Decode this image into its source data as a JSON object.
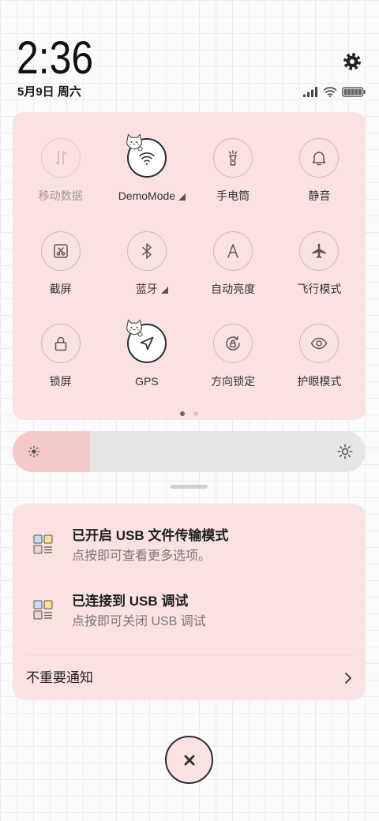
{
  "status_bar": {
    "time": "2:36",
    "date": "5月9日 周六",
    "icons": [
      "signal-icon",
      "wifi-icon",
      "battery-icon"
    ]
  },
  "header": {
    "settings_icon": "gear-icon"
  },
  "quick_settings": {
    "tiles": [
      {
        "label": "移动数据",
        "icon": "mobile-data-icon",
        "active": false,
        "disabled": true,
        "has_more": false
      },
      {
        "label": "DemoMode",
        "icon": "wifi-icon",
        "active": true,
        "disabled": false,
        "has_more": true
      },
      {
        "label": "手电筒",
        "icon": "flashlight-icon",
        "active": false,
        "disabled": false,
        "has_more": false
      },
      {
        "label": "静音",
        "icon": "bell-icon",
        "active": false,
        "disabled": false,
        "has_more": false
      },
      {
        "label": "截屏",
        "icon": "screenshot-icon",
        "active": false,
        "disabled": false,
        "has_more": false
      },
      {
        "label": "蓝牙",
        "icon": "bluetooth-icon",
        "active": false,
        "disabled": false,
        "has_more": true
      },
      {
        "label": "自动亮度",
        "icon": "auto-brightness-icon",
        "active": false,
        "disabled": false,
        "has_more": false
      },
      {
        "label": "飞行模式",
        "icon": "airplane-icon",
        "active": false,
        "disabled": false,
        "has_more": false
      },
      {
        "label": "锁屏",
        "icon": "lock-icon",
        "active": false,
        "disabled": false,
        "has_more": false
      },
      {
        "label": "GPS",
        "icon": "location-arrow-icon",
        "active": true,
        "disabled": false,
        "has_more": false
      },
      {
        "label": "方向锁定",
        "icon": "rotation-lock-icon",
        "active": false,
        "disabled": false,
        "has_more": false
      },
      {
        "label": "护眼模式",
        "icon": "eye-icon",
        "active": false,
        "disabled": false,
        "has_more": false
      }
    ],
    "page": {
      "current": 1,
      "total": 2
    }
  },
  "brightness": {
    "level": 0.22,
    "icons": [
      "sun-small-icon",
      "sun-large-icon"
    ]
  },
  "notifications": {
    "items": [
      {
        "title": "已开启 USB 文件传输模式",
        "subtitle": "点按即可查看更多选项。",
        "icon": "usb-settings-app-icon"
      },
      {
        "title": "已连接到 USB 调试",
        "subtitle": "点按即可关闭 USB 调试",
        "icon": "usb-settings-app-icon"
      }
    ],
    "unimportant_label": "不重要通知"
  },
  "close_button": {
    "icon": "close-icon"
  },
  "theme": {
    "panel": "#fbe2e2",
    "slider_fill": "#f6c9c9",
    "slider_track": "#e6e6e6",
    "active_tile": "#ffffff"
  }
}
